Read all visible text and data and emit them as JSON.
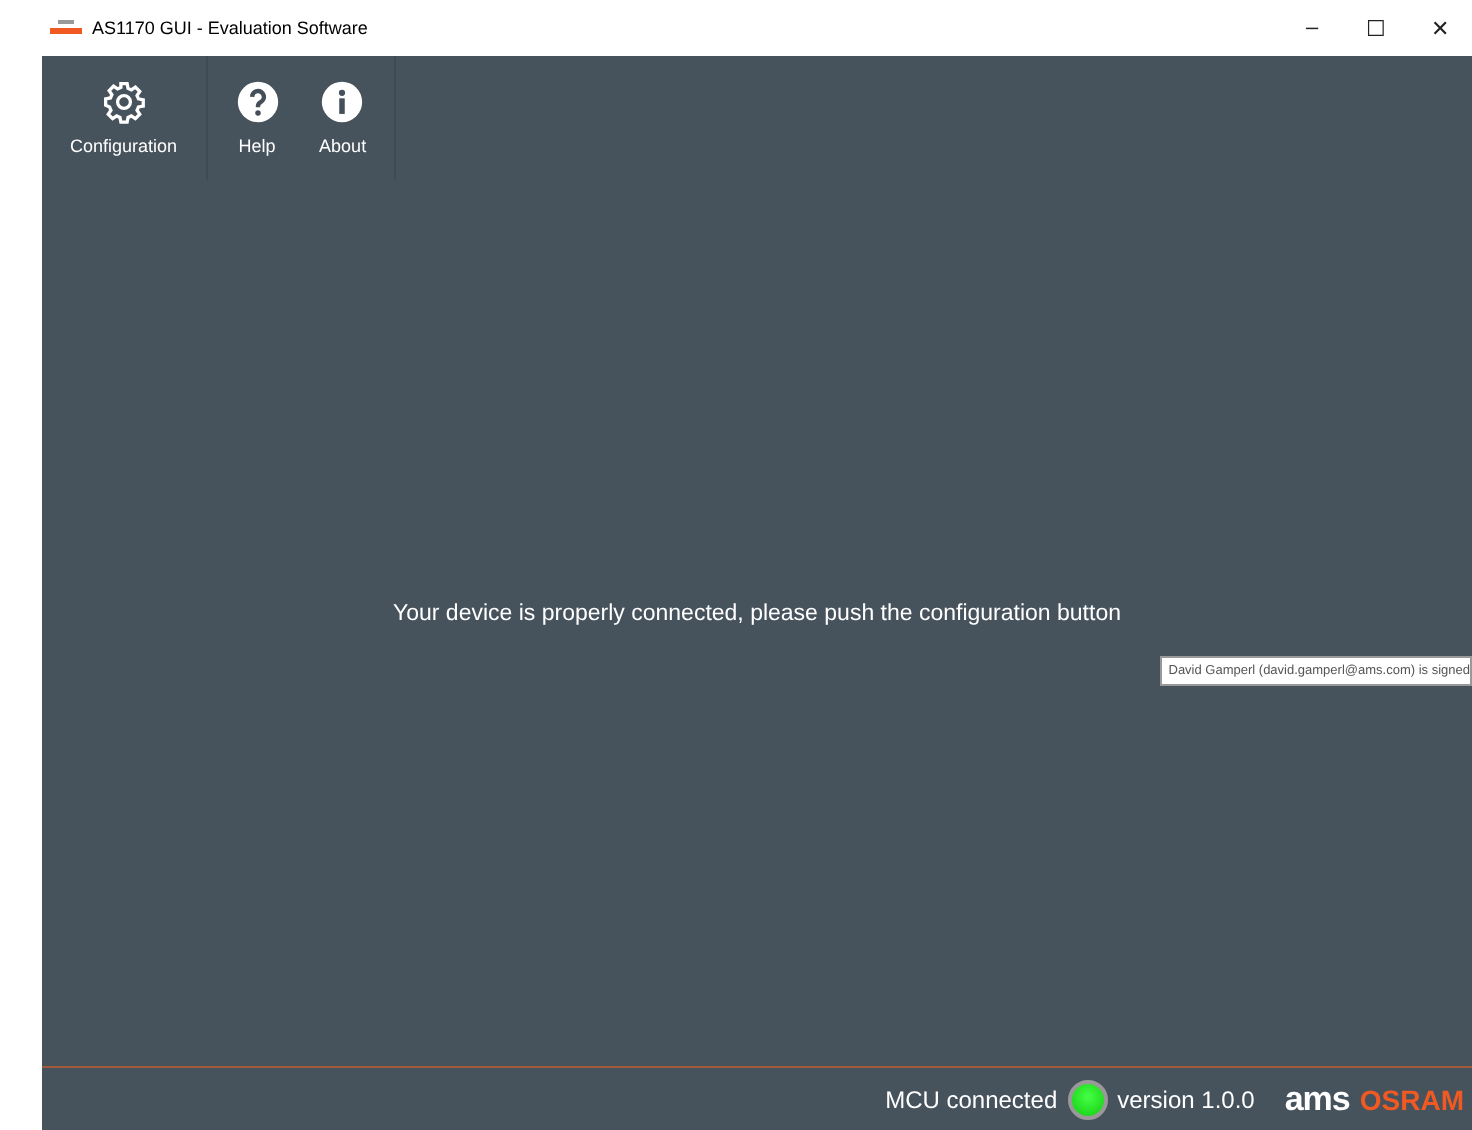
{
  "window": {
    "title": "AS1170 GUI - Evaluation Software",
    "controls": [
      "–",
      "☐",
      "✕"
    ]
  },
  "toolbar": {
    "groups": [
      [
        {
          "label": "Configuration",
          "kind": "settings"
        }
      ],
      [
        {
          "label": "Help",
          "kind": "help"
        },
        {
          "label": "About",
          "kind": "info"
        }
      ]
    ]
  },
  "message": "Your device is properly connected, please push the configuration button",
  "tooltip": "David Gamperl (david.gamperl@ams.com) is signed",
  "status_bar": {
    "mcu_label": "MCU connected",
    "mcu_connected": true,
    "version": "version 1.0.0",
    "logo_primary": "ams",
    "logo_secondary": "OSRAM"
  }
}
